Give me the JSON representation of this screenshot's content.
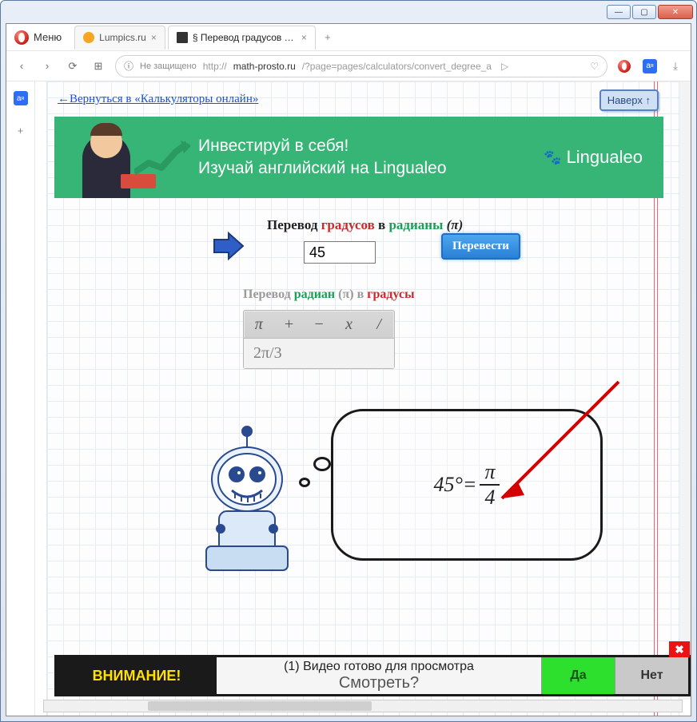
{
  "win": {
    "min": "—",
    "max": "▢",
    "close": "✕"
  },
  "opera": {
    "menu": "Меню",
    "tabs": [
      {
        "label": "Lumpics.ru"
      },
      {
        "label": "§ Перевод градусов в рад"
      }
    ],
    "newtab": "+",
    "nav": {
      "back": "‹",
      "fwd": "›",
      "reload": "⟳",
      "speed": "⊞"
    },
    "addr": {
      "secure": "Не защищено",
      "protocol": "http://",
      "host": "math-prosto.ru",
      "path": "/?page=pages/calculators/convert_degree_a",
      "go": "▷",
      "heart": "♡"
    },
    "right": {
      "dl": "⤓"
    }
  },
  "sidebar": {
    "plus": "+"
  },
  "page": {
    "back_link": "←Вернуться в «Калькуляторы онлайн»",
    "to_top": "Наверх ↑",
    "ad": {
      "line1": "Инвестируй в себя!",
      "line2": "Изучай английский на Lingualeo",
      "brand": "Lingualeo"
    },
    "conv1": {
      "t1": "Перевод ",
      "t2": "градусов",
      "t3": " в ",
      "t4": "радианы",
      "t5": " (π)",
      "value": "45",
      "btn": "Перевести"
    },
    "conv2": {
      "t1": "Перевод ",
      "t2": "радиан",
      "t3": " (π) в ",
      "t4": "градусы",
      "keys": [
        "π",
        "+",
        "−",
        "x",
        "/"
      ],
      "value": "2π/3"
    },
    "result": {
      "lhs": "45°=",
      "num": "π",
      "den": "4"
    },
    "bottom": {
      "warn": "ВНИМАНИЕ!",
      "l1": "(1) Видео готово для просмотра",
      "l2": "Смотреть?",
      "yes": "Да",
      "no": "Нет",
      "close": "✖"
    }
  }
}
